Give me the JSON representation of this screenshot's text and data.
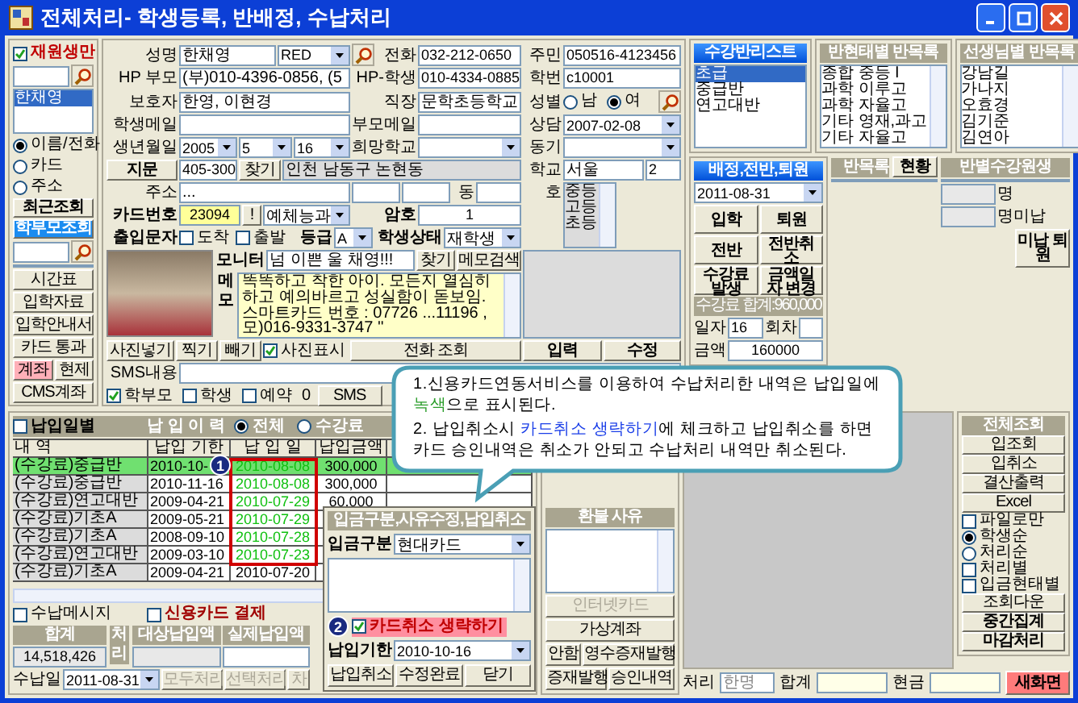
{
  "window": {
    "title": "전체처리- 학생등록, 반배정, 수납처리"
  },
  "left_panel": {
    "active_only": {
      "label": "재원생만",
      "checked": true
    },
    "results": [
      {
        "name": "한채영",
        "selected": true
      }
    ],
    "search_modes": [
      {
        "label": "이름/전화",
        "selected": true
      },
      {
        "label": "카드",
        "selected": false
      },
      {
        "label": "주소",
        "selected": false
      }
    ],
    "recent_button": "최근조회",
    "parent_search_button": "학부모조회",
    "buttons": [
      [
        {
          "label": "시간표",
          "alert": false
        }
      ],
      [
        {
          "label": "입학자료",
          "alert": false
        }
      ],
      [
        {
          "label": "입학안내서",
          "alert": false
        }
      ],
      [
        {
          "label": "카드 통과",
          "alert": false
        }
      ],
      [
        {
          "label": "계좌",
          "alert": true
        },
        {
          "label": "현제",
          "alert": false
        }
      ],
      [
        {
          "label": "CMS계좌",
          "alert": false
        }
      ]
    ]
  },
  "student": {
    "name": {
      "label": "성명",
      "value": "한채영"
    },
    "color_tag": "RED",
    "phone": {
      "label": "전화",
      "value": "032-212-0650"
    },
    "resident_no": {
      "label": "주민",
      "value": "050516-4123456"
    },
    "parent_hp": {
      "label": "HP 부모",
      "value": "(부)010-4396-0856, (5"
    },
    "student_hp": {
      "label": "HP-학생",
      "value": "010-4334-0885"
    },
    "student_id": {
      "label": "학번",
      "value": "c10001"
    },
    "guardian": {
      "label": "보호자",
      "value": "한영, 이현경"
    },
    "workplace": {
      "label": "직장",
      "value": "문학초등학교"
    },
    "gender": {
      "label": "성별",
      "options": [
        {
          "label": "남",
          "selected": false
        },
        {
          "label": "여",
          "selected": true
        }
      ]
    },
    "student_email": {
      "label": "학생메일"
    },
    "parent_email": {
      "label": "부모메일"
    },
    "consult": {
      "label": "상담",
      "value": "2007-02-08"
    },
    "birth": {
      "label": "생년월일",
      "year": "2005",
      "month": "5",
      "day": "16"
    },
    "wish_school": {
      "label": "희망학교"
    },
    "motive": {
      "label": "동기"
    },
    "fingerprint_button": "지문",
    "zip": "405-300",
    "find_button": "찾기",
    "address1": "인천 남동구 논현동",
    "school": {
      "label": "학교",
      "value": "서울",
      "grade": "2"
    },
    "address": {
      "label": "주소",
      "value": "..."
    },
    "dong_label": "동",
    "ho_label": "호",
    "school_levels": [
      "중등",
      "고등",
      "초등"
    ],
    "card": {
      "label": "카드번호",
      "value": "23094",
      "mark_button": "!",
      "course": "예체능과"
    },
    "password": {
      "label": "암호",
      "value": "1"
    },
    "entry_sms": {
      "label": "출입문자",
      "options": [
        {
          "label": "도착",
          "checked": false
        },
        {
          "label": "출발",
          "checked": false
        }
      ]
    },
    "grade": {
      "label": "등급",
      "value": "A"
    },
    "status": {
      "label": "학생상태",
      "value": "재학생"
    },
    "monitor": {
      "label": "모니터",
      "value": "넘 이쁜 울 채영!!!",
      "find_button": "찾기",
      "memo_search_button": "메모검색"
    },
    "memo": {
      "label": "메모",
      "text": "똑똑하고 착한 아이. 모든지 열심히 하고 예의바르고 성실함이 돋보임. 스마트카드 번호 : 07726 ...11196 ,모)016-9331-3747 ''"
    },
    "photo_buttons": [
      "사진넣기",
      "찍기",
      "빼기"
    ],
    "show_photo": {
      "label": "사진표시",
      "checked": true
    },
    "phone_lookup_button": "전화 조회",
    "action_buttons": [
      "입력",
      "수정"
    ],
    "sms": {
      "label": "SMS내용",
      "targets": [
        {
          "label": "학부모",
          "checked": true
        },
        {
          "label": "학생",
          "checked": false
        },
        {
          "label": "예약",
          "checked": false
        }
      ],
      "count": "0",
      "send_button": "SMS"
    }
  },
  "course_list": {
    "title": "수강반리스트",
    "items": [
      {
        "label": "초급",
        "selected": true
      },
      {
        "label": "중급반",
        "selected": false
      },
      {
        "label": "연고대반",
        "selected": false
      }
    ]
  },
  "class_by_type": {
    "title": "반현태별 반목록",
    "items": [
      "종합 중등 I",
      "과학 이루고",
      "과학 자율고",
      "기타 영재,과고",
      "기타 자율고"
    ]
  },
  "class_by_teacher": {
    "title": "선생님별 반목록",
    "items": [
      "강남길",
      "가나지",
      "오효경",
      "김기준",
      "김연아"
    ]
  },
  "assignment": {
    "title": "배정,전반,퇴원",
    "date": "2011-08-31",
    "buttons": [
      "입학",
      "퇴원",
      "전반",
      "전반취소",
      "수강료 발생",
      "금액일자 변경"
    ],
    "total": "수강료 합계:960,000",
    "day_label": "일자",
    "day": "16",
    "round_label": "회차",
    "amount_label": "금액",
    "amount": "160000"
  },
  "class_status": {
    "label": "반목록",
    "button": "현황"
  },
  "class_students": {
    "title": "반별수강원생"
  },
  "counts": {
    "count_label": "명",
    "unpaid_label": "명미납",
    "unpaid_leave_button": "미납 퇴원"
  },
  "payments": {
    "by_date": {
      "label": "납입일별",
      "checked": false
    },
    "title": "납 입 이 력",
    "filters": [
      {
        "label": "전체",
        "selected": true
      },
      {
        "label": "수강료",
        "selected": false
      }
    ],
    "columns": [
      "내 역",
      "납입 기한",
      "납 입 일",
      "납입금액"
    ],
    "rows": [
      {
        "item": "(수강료)중급반",
        "due": "2010-10-",
        "paid": "2010-08-08",
        "amount": "300,000",
        "kind": "card",
        "selected": true
      },
      {
        "item": "(수강료)중급반",
        "due": "2010-11-16",
        "paid": "2010-08-08",
        "amount": "300,000",
        "kind": "card",
        "selected": false
      },
      {
        "item": "(수강료)연고대반",
        "due": "2009-04-21",
        "paid": "2010-07-29",
        "amount": "60,000",
        "kind": "card",
        "selected": false
      },
      {
        "item": "(수강료)기초A",
        "due": "2009-05-21",
        "paid": "2010-07-29",
        "kind": "card",
        "selected": false
      },
      {
        "item": "(수강료)기초A",
        "due": "2008-09-10",
        "paid": "2010-07-28",
        "kind": "card",
        "selected": false
      },
      {
        "item": "(수강료)연고대반",
        "due": "2009-03-10",
        "paid": "2010-07-23",
        "kind": "card",
        "selected": false
      },
      {
        "item": "(수강료)기초A",
        "due": "2009-04-21",
        "paid": "2010-07-20",
        "kind": "cash",
        "selected": false
      }
    ],
    "row_badge": "1",
    "message": {
      "label": "수납메시지",
      "checked": false
    },
    "card_payment": {
      "label": "신용카드 결제",
      "checked": false
    },
    "sum_label": "합계",
    "sum": "14,518,426",
    "process_label": "처리",
    "target_label": "대상납입액",
    "actual_label": "실제납입액",
    "pay_date": {
      "label": "수납일",
      "value": "2011-08-31"
    },
    "process_buttons": [
      {
        "label": "모두처리",
        "disabled": true
      },
      {
        "label": "선택처리",
        "disabled": true
      },
      {
        "label": "차",
        "disabled": true
      }
    ]
  },
  "edit_popup": {
    "title": "입금구분,사유수정,납입취소",
    "method": {
      "label": "입금구분",
      "value": "현대카드"
    },
    "badge": "2",
    "skip_card_cancel": {
      "label": "카드취소 생략하기",
      "checked": true
    },
    "due": {
      "label": "납입기한",
      "value": "2010-10-16"
    },
    "buttons": [
      "납입취소",
      "수정완료",
      "닫기"
    ]
  },
  "refund": {
    "title": "환불 사유",
    "buttons": [
      [
        {
          "label": "인터넷카드",
          "disabled": true
        }
      ],
      [
        {
          "label": "가상계좌",
          "disabled": false
        }
      ],
      [
        {
          "label": "안함",
          "disabled": false
        },
        {
          "label": "영수증재발행",
          "disabled": false
        }
      ],
      [
        {
          "label": "증재발행",
          "disabled": false
        },
        {
          "label": "승인내역",
          "disabled": false
        }
      ]
    ]
  },
  "report": {
    "title": "전체조회",
    "buttons": [
      "입조회",
      "입취소",
      "결산출력",
      "Excel"
    ],
    "options": [
      {
        "kind": "check",
        "label": "파일로만",
        "checked": false
      },
      {
        "kind": "radio",
        "label": "학생순",
        "selected": true
      },
      {
        "kind": "radio",
        "label": "처리순",
        "selected": false
      },
      {
        "kind": "check",
        "label": "처리별",
        "checked": false
      },
      {
        "kind": "check",
        "label": "입금현태별",
        "checked": false
      }
    ],
    "bottom_buttons": [
      "조회다운",
      "중간집계",
      "마감처리"
    ]
  },
  "status_bar": {
    "process_label": "처리",
    "process_value": "한명",
    "sum_label": "합계",
    "cash_label": "현금",
    "new_screen_button": "새화면"
  },
  "callout": {
    "notes": [
      {
        "segments": [
          {
            "text": "1.신용카드연동서비스를 이용하여 수납처리한 내역은 납입일에 ",
            "color": "#000000"
          },
          {
            "text": "녹색",
            "color": "#2a9d2a"
          },
          {
            "text": "으로 표시된다.",
            "color": "#000000"
          }
        ]
      },
      {
        "segments": [
          {
            "text": "2. 납입취소시 ",
            "color": "#000000"
          },
          {
            "text": "카드취소 생략하기",
            "color": "#1a3ee8"
          },
          {
            "text": "에 체크하고 납입취소를 하면 카드 승인내역은 취소가 안되고 수납처리 내역만 취소된다.",
            "color": "#000000"
          }
        ]
      }
    ]
  }
}
